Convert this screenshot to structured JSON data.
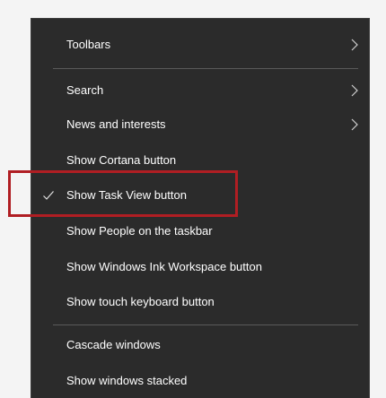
{
  "menu": {
    "items": [
      {
        "label": "Toolbars",
        "submenu": true,
        "checked": false
      },
      {
        "label": "Search",
        "submenu": true,
        "checked": false
      },
      {
        "label": "News and interests",
        "submenu": true,
        "checked": false
      },
      {
        "label": "Show Cortana button",
        "submenu": false,
        "checked": false
      },
      {
        "label": "Show Task View button",
        "submenu": false,
        "checked": true
      },
      {
        "label": "Show People on the taskbar",
        "submenu": false,
        "checked": false
      },
      {
        "label": "Show Windows Ink Workspace button",
        "submenu": false,
        "checked": false
      },
      {
        "label": "Show touch keyboard button",
        "submenu": false,
        "checked": false
      },
      {
        "label": "Cascade windows",
        "submenu": false,
        "checked": false
      },
      {
        "label": "Show windows stacked",
        "submenu": false,
        "checked": false
      }
    ]
  },
  "icons": {
    "submenu": "chevron-right-icon",
    "checked": "checkmark-icon"
  },
  "colors": {
    "menu_background": "#2b2b2b",
    "menu_text": "#ffffff",
    "separator": "#5a5a5a",
    "highlight_box": "#b01e23",
    "page_background": "#f4f4f4"
  }
}
